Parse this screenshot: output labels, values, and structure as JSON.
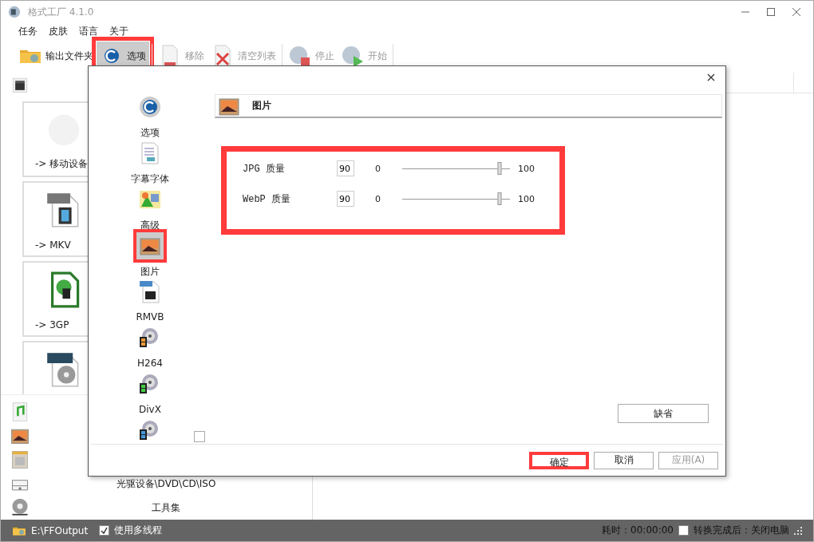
{
  "window": {
    "title": "格式工厂 4.1.0"
  },
  "menu": [
    "任务",
    "皮肤",
    "语言",
    "关于"
  ],
  "toolbar": [
    {
      "kind": "folder",
      "label": "输出文件夹",
      "disabled": false,
      "highlighted": false
    },
    {
      "kind": "options",
      "label": "选项",
      "disabled": false,
      "highlighted": true
    },
    {
      "kind": "remove",
      "label": "移除",
      "disabled": true,
      "highlighted": false
    },
    {
      "kind": "clear",
      "label": "清空列表",
      "disabled": true,
      "highlighted": false
    },
    {
      "kind": "stop",
      "label": "停止",
      "disabled": true,
      "highlighted": false
    },
    {
      "kind": "start",
      "label": "开始",
      "disabled": true,
      "highlighted": false
    }
  ],
  "sidebar": {
    "top_category": {
      "kind": "video"
    },
    "cards": [
      {
        "kind": "mobile",
        "label": "-> 移动设备"
      },
      {
        "kind": "mkv",
        "label": "-> MKV"
      },
      {
        "kind": "phone",
        "label": "-> 3GP"
      },
      {
        "kind": "mpeg"
      }
    ],
    "categories": [
      {
        "kind": "audio"
      },
      {
        "kind": "picture"
      },
      {
        "kind": "document"
      },
      {
        "kind": "disc",
        "label": "光驱设备\\DVD\\CD\\ISO"
      },
      {
        "kind": "tools",
        "label": "工具集"
      }
    ]
  },
  "dialog": {
    "nav": [
      {
        "kind": "options",
        "label": "选项",
        "selected": false,
        "highlighted": false
      },
      {
        "kind": "subtitle",
        "label": "字幕字体",
        "selected": false,
        "highlighted": false
      },
      {
        "kind": "advanced",
        "label": "高级",
        "selected": false,
        "highlighted": false
      },
      {
        "kind": "picture",
        "label": "图片",
        "selected": true,
        "highlighted": true
      },
      {
        "kind": "rmvb",
        "label": "RMVB",
        "selected": false,
        "highlighted": false
      },
      {
        "kind": "film-orange",
        "label": "H264",
        "selected": false,
        "highlighted": false
      },
      {
        "kind": "film-green",
        "label": "DivX",
        "selected": false,
        "highlighted": false
      },
      {
        "kind": "film-blue",
        "selected": false,
        "highlighted": false
      }
    ],
    "section": {
      "title": "图片"
    },
    "quality": {
      "highlighted": true,
      "rows": [
        {
          "label": "JPG 质量",
          "value": "90",
          "min": "0",
          "max": "100",
          "level": 0.9
        },
        {
          "label": "WebP 质量",
          "value": "90",
          "min": "0",
          "max": "100",
          "level": 0.9
        }
      ]
    },
    "default_button": "缺省",
    "buttons": [
      {
        "label": "确定",
        "disabled": false,
        "highlighted": true
      },
      {
        "label": "取消",
        "disabled": false,
        "highlighted": false
      },
      {
        "label": "应用(A)",
        "disabled": true,
        "highlighted": false
      }
    ]
  },
  "status_bar": {
    "output_path": "E:\\FFOutput",
    "multithread": {
      "label": "使用多线程",
      "checked": true
    },
    "elapsed": "耗时：00:00:00",
    "shutdown": {
      "label": "转换完成后：关闭电脑",
      "checked": false
    }
  }
}
